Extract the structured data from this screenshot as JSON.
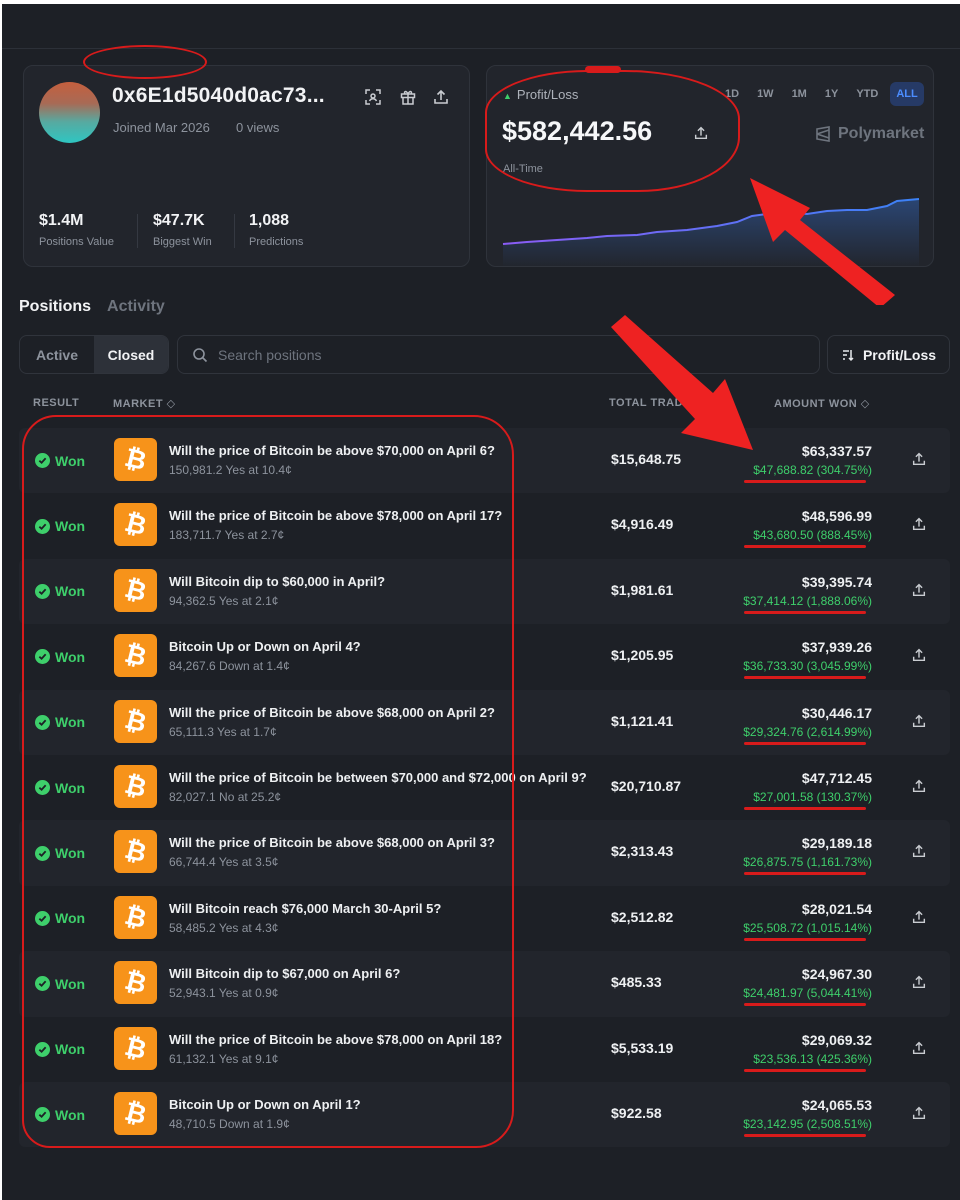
{
  "profile": {
    "username": "0x6E1d5040d0ac73...",
    "joined": "Joined Mar 2026",
    "views": "0 views",
    "icons": [
      "scan-icon",
      "gift-icon",
      "share-icon"
    ],
    "stats": [
      {
        "value": "$1.4M",
        "label": "Positions Value"
      },
      {
        "value": "$47.7K",
        "label": "Biggest Win"
      },
      {
        "value": "1,088",
        "label": "Predictions"
      }
    ]
  },
  "pnl": {
    "label": "Profit/Loss",
    "value": "$582,442.56",
    "period": "All-Time",
    "ranges": [
      "1D",
      "1W",
      "1M",
      "1Y",
      "YTD",
      "ALL"
    ],
    "active_range": "ALL",
    "brand": "Polymarket"
  },
  "tabs": {
    "positions": "Positions",
    "activity": "Activity"
  },
  "filters": {
    "active": "Active",
    "closed": "Closed",
    "search_placeholder": "Search positions",
    "sort": "Profit/Loss"
  },
  "headers": {
    "result": "RESULT",
    "market": "MARKET",
    "total_traded": "TOTAL TRADE",
    "amount_won": "AMOUNT WON"
  },
  "colors": {
    "accent_green": "#3ecf6b",
    "bitcoin": "#f7931a",
    "annotation_red": "#d81b1b",
    "active_range_blue": "#4c8dff"
  },
  "positions": [
    {
      "result": "Won",
      "title": "Will the price of Bitcoin be above $70,000 on April 6?",
      "detail": "150,981.2 Yes at 10.4¢",
      "traded": "$15,648.75",
      "won": "$63,337.57",
      "gain": "$47,688.82 (304.75%)"
    },
    {
      "result": "Won",
      "title": "Will the price of Bitcoin be above $78,000 on April 17?",
      "detail": "183,711.7 Yes at 2.7¢",
      "traded": "$4,916.49",
      "won": "$48,596.99",
      "gain": "$43,680.50 (888.45%)"
    },
    {
      "result": "Won",
      "title": "Will Bitcoin dip to $60,000 in April?",
      "detail": "94,362.5 Yes at 2.1¢",
      "traded": "$1,981.61",
      "won": "$39,395.74",
      "gain": "$37,414.12 (1,888.06%)"
    },
    {
      "result": "Won",
      "title": "Bitcoin Up or Down on April 4?",
      "detail": "84,267.6 Down at 1.4¢",
      "traded": "$1,205.95",
      "won": "$37,939.26",
      "gain": "$36,733.30 (3,045.99%)"
    },
    {
      "result": "Won",
      "title": "Will the price of Bitcoin be above $68,000 on April 2?",
      "detail": "65,111.3 Yes at 1.7¢",
      "traded": "$1,121.41",
      "won": "$30,446.17",
      "gain": "$29,324.76 (2,614.99%)"
    },
    {
      "result": "Won",
      "title": "Will the price of Bitcoin be between $70,000 and $72,000 on April 9?",
      "detail": "82,027.1 No at 25.2¢",
      "traded": "$20,710.87",
      "won": "$47,712.45",
      "gain": "$27,001.58 (130.37%)"
    },
    {
      "result": "Won",
      "title": "Will the price of Bitcoin be above $68,000 on April 3?",
      "detail": "66,744.4 Yes at 3.5¢",
      "traded": "$2,313.43",
      "won": "$29,189.18",
      "gain": "$26,875.75 (1,161.73%)"
    },
    {
      "result": "Won",
      "title": "Will Bitcoin reach $76,000 March 30-April 5?",
      "detail": "58,485.2 Yes at 4.3¢",
      "traded": "$2,512.82",
      "won": "$28,021.54",
      "gain": "$25,508.72 (1,015.14%)"
    },
    {
      "result": "Won",
      "title": "Will Bitcoin dip to $67,000 on April 6?",
      "detail": "52,943.1 Yes at 0.9¢",
      "traded": "$485.33",
      "won": "$24,967.30",
      "gain": "$24,481.97 (5,044.41%)"
    },
    {
      "result": "Won",
      "title": "Will the price of Bitcoin be above $78,000 on April 18?",
      "detail": "61,132.1 Yes at 9.1¢",
      "traded": "$5,533.19",
      "won": "$29,069.32",
      "gain": "$23,536.13 (425.36%)"
    },
    {
      "result": "Won",
      "title": "Bitcoin Up or Down on April 1?",
      "detail": "48,710.5 Down at 1.9¢",
      "traded": "$922.58",
      "won": "$24,065.53",
      "gain": "$23,142.95 (2,508.51%)"
    }
  ]
}
